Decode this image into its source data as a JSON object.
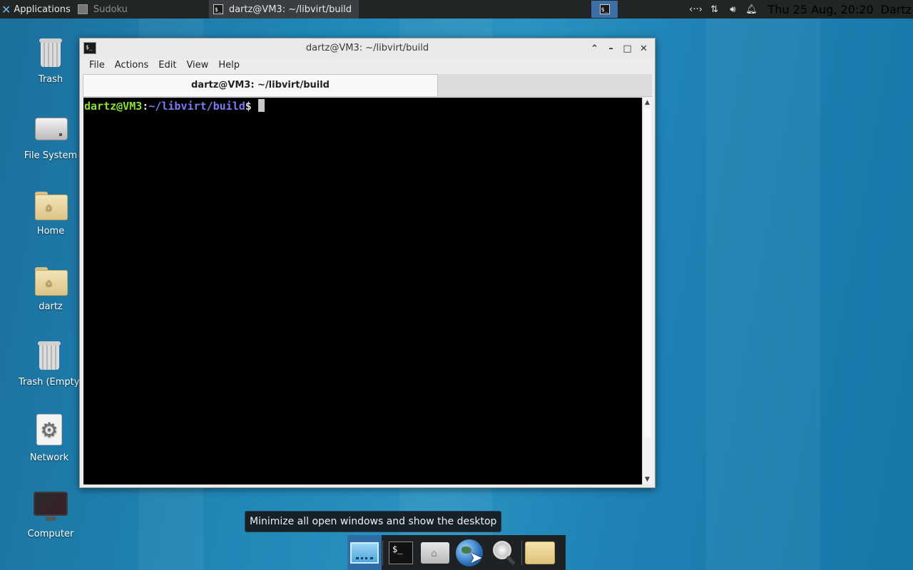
{
  "top_panel": {
    "applications_label": "Applications",
    "tasks": [
      {
        "label": "Sudoku"
      },
      {
        "label": "dartz@VM3: ~/libvirt/build"
      }
    ],
    "tray": {
      "network_icon": "network-arrows-icon",
      "transfer_icon": "up-down-arrows-icon",
      "volume_icon": "speaker-icon",
      "notification_icon": "bell-icon"
    },
    "clock": "Thu 25 Aug, 20:20",
    "user": "Dartz"
  },
  "desktop_icons": [
    {
      "label": "Trash"
    },
    {
      "label": "File System"
    },
    {
      "label": "Home"
    },
    {
      "label": "dartz"
    },
    {
      "label": "Trash (Empty)"
    },
    {
      "label": "Network"
    },
    {
      "label": "Computer"
    }
  ],
  "terminal_window": {
    "title": "dartz@VM3: ~/libvirt/build",
    "menu": [
      "File",
      "Actions",
      "Edit",
      "View",
      "Help"
    ],
    "tab_label": "dartz@VM3: ~/libvirt/build",
    "prompt": {
      "user_host": "dartz@VM3",
      "colon": ":",
      "path": "~/libvirt/build",
      "dollar": "$"
    }
  },
  "tooltip": "Minimize all open windows and show the desktop",
  "dock": {
    "items": [
      "show-desktop",
      "terminal",
      "home-folder",
      "web-browser",
      "search",
      "file-manager"
    ]
  },
  "colors": {
    "prompt_user": "#8ae234",
    "prompt_path": "#7b7bf5",
    "panel_bg": "#222526",
    "desktop_accent": "#1f86b6"
  }
}
